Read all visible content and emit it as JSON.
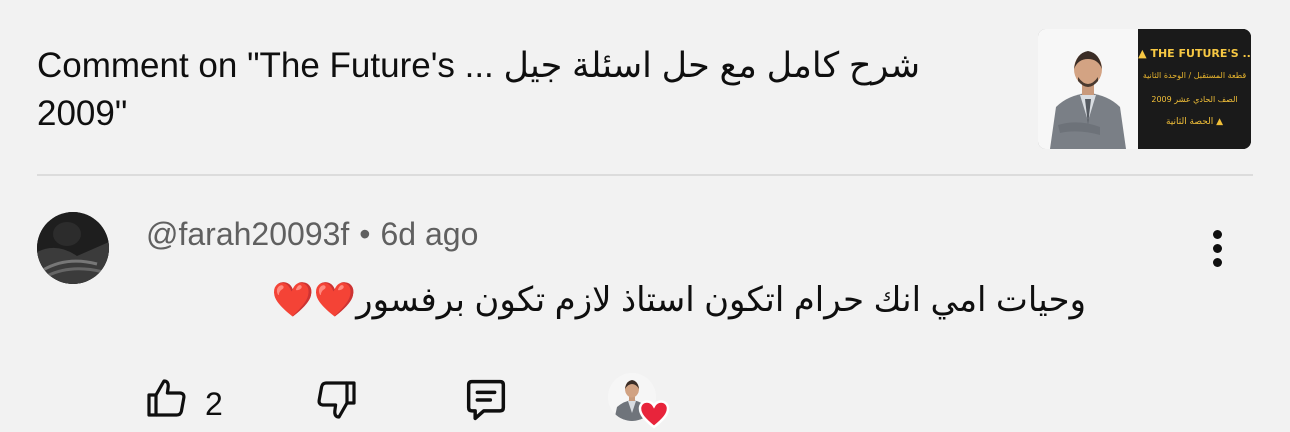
{
  "header": {
    "title": "Comment on \"The Future's ... شرح كامل مع حل اسئلة جيل 2009\"",
    "thumbnail": {
      "line1": "▲ THE FUTURE'S ..",
      "line2": "قطعة المستقبل / الوحدة الثانية",
      "line3": "الصف الحادي عشر 2009",
      "line4": "الحصة الثانية ▲"
    }
  },
  "comment": {
    "author": "@farah20093f",
    "separator": "•",
    "time": "6d ago",
    "text": "وحيات امي انك حرام اتكون استاذ لازم تكون برفسور❤️❤️",
    "like_count": "2",
    "heart_color": "#e8243b"
  },
  "icons": {
    "more": "vertical-dots-icon",
    "like": "thumbs-up-icon",
    "dislike": "thumbs-down-icon",
    "reply": "comment-icon",
    "creator_heart": "heart-icon"
  }
}
